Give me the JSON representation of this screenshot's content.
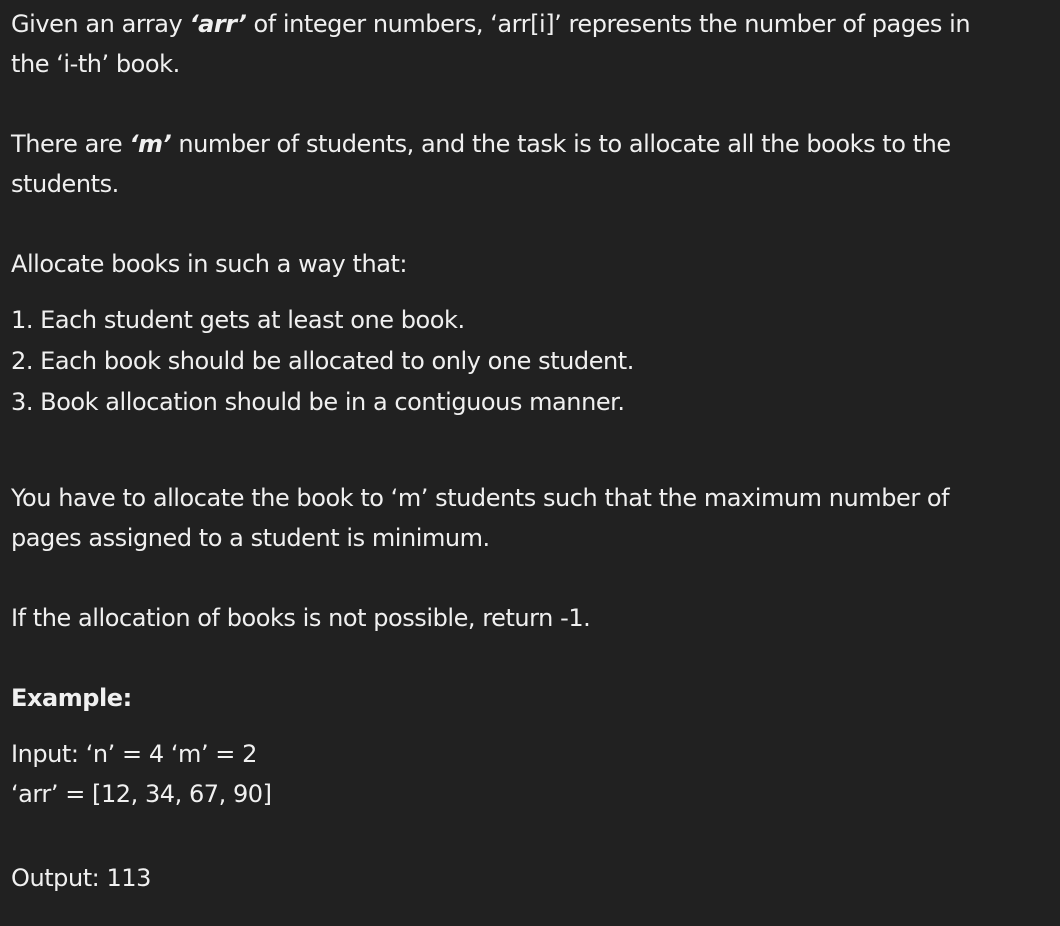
{
  "intro": {
    "part1": "Given an array ",
    "arr_term": "‘arr’",
    "part2": " of integer numbers, ‘arr[i]’ represents the number of pages in",
    "part3": "the ‘i-th’ book."
  },
  "students": {
    "part1": "There are ",
    "m_term": "‘m’",
    "part2": " number of students, and the task is to allocate all the books to the",
    "part3": "students."
  },
  "allocate_heading": "Allocate books in such a way that:",
  "rules": [
    "1. Each student gets at least one book.",
    "2. Each book should be allocated to only one student.",
    "3. Book allocation should be in a contiguous manner."
  ],
  "goal": {
    "line1": "You have to allocate the book to ‘m’ students such that the maximum number of",
    "line2": "pages assigned to a student is minimum."
  },
  "impossible": "If the allocation of books is not possible, return -1.",
  "example": {
    "heading": "Example:",
    "input_line1": "Input: ‘n’ = 4 ‘m’ = 2",
    "input_line2": "‘arr’ = [12, 34, 67, 90]",
    "output": "Output: 113"
  }
}
